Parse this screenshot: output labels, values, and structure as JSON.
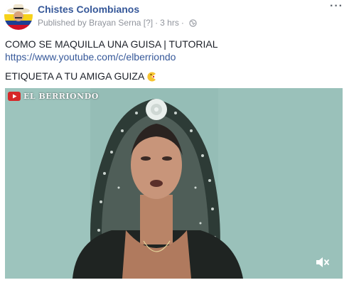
{
  "post": {
    "page_name": "Chistes Colombianos",
    "published_prefix": "Published by",
    "author": "Brayan Serna",
    "author_marker": "[?]",
    "separator": "·",
    "time": "3 hrs",
    "separator2": "·",
    "menu_label": "···",
    "lines": {
      "title": "COMO SE MAQUILLA UNA GUISA | TUTORIAL",
      "link": "https://www.youtube.com/c/elberriondo",
      "tagline": "ETIQUETA A TU AMIGA GUIZA"
    }
  },
  "video": {
    "watermark_text": "EL BERRIONDO",
    "icons": {
      "watermark": "youtube-icon",
      "sound": "speaker-muted-icon",
      "privacy": "globe-icon",
      "emoji": "pacman-face-icon"
    }
  },
  "colors": {
    "link": "#365899",
    "meta": "#90949c",
    "text": "#1d2129",
    "video_bg": "#8fb8b2"
  }
}
